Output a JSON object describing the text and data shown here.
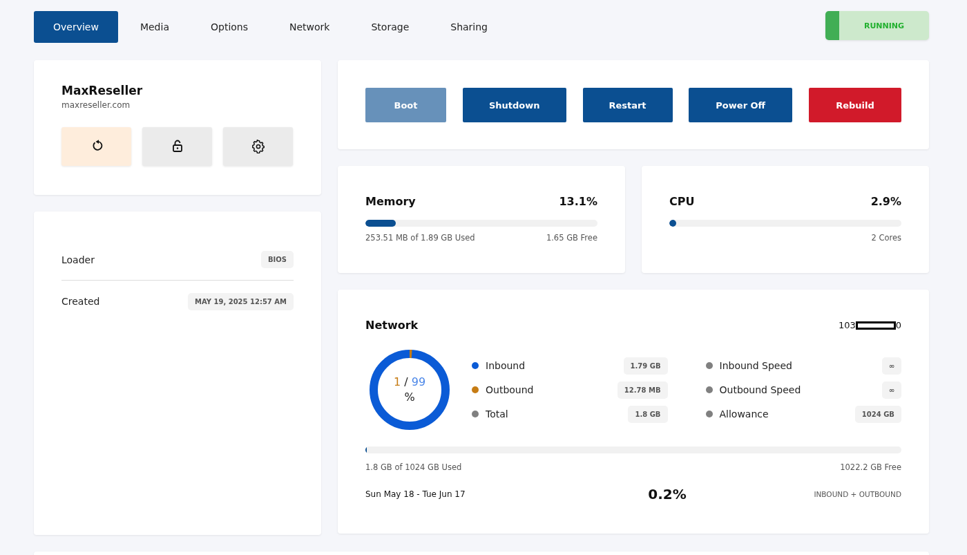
{
  "tabs": [
    {
      "label": "Overview",
      "selected": true
    },
    {
      "label": "Media",
      "selected": false
    },
    {
      "label": "Options",
      "selected": false
    },
    {
      "label": "Network",
      "selected": false
    },
    {
      "label": "Storage",
      "selected": false
    },
    {
      "label": "Sharing",
      "selected": false
    }
  ],
  "status": {
    "label": "RUNNING"
  },
  "server": {
    "name": "MaxReseller",
    "domain": "maxreseller.com",
    "icon_buttons": [
      {
        "kind": "refresh",
        "color": "#feeddc"
      },
      {
        "kind": "unlock",
        "color": "#ebebeb"
      },
      {
        "kind": "settings",
        "color": "#ebebeb"
      }
    ]
  },
  "details": [
    {
      "label": "Loader",
      "value": "BIOS"
    },
    {
      "label": "Created",
      "value": "MAY 19, 2025 12:57 AM"
    }
  ],
  "actions": [
    {
      "label": "Boot",
      "kind": "primary",
      "disabled": true
    },
    {
      "label": "Shutdown",
      "kind": "primary",
      "disabled": false
    },
    {
      "label": "Restart",
      "kind": "primary",
      "disabled": false
    },
    {
      "label": "Power Off",
      "kind": "primary",
      "disabled": false
    },
    {
      "label": "Rebuild",
      "kind": "danger",
      "disabled": false
    }
  ],
  "meters": [
    {
      "title": "Memory",
      "percent": "13.1%",
      "level": 0.131,
      "left": "253.51 MB of 1.89 GB Used",
      "right": "1.65 GB Free"
    },
    {
      "title": "CPU",
      "percent": "2.9%",
      "level": 0.029,
      "right": "2 Cores"
    }
  ],
  "network": {
    "title": "Network",
    "address_start": "103",
    "address_end": "0",
    "donut": {
      "level": 0.01
    },
    "center": {
      "outbound": "1",
      "separator": "/",
      "inbound": "99",
      "unit": "%"
    },
    "stats": [
      {
        "label": "Inbound",
        "value": "1.79 GB",
        "color": "#0b5bd6"
      },
      {
        "label": "Outbound",
        "value": "12.78 MB",
        "color": "#c67c14"
      },
      {
        "label": "Total",
        "value": "1.8 GB",
        "color": "#808080"
      }
    ],
    "limits": [
      {
        "label": "Inbound Speed",
        "value": "∞",
        "color": "#808080"
      },
      {
        "label": "Outbound Speed",
        "value": "∞",
        "color": "#808080"
      },
      {
        "label": "Allowance",
        "value": "1024 GB",
        "color": "#808080"
      }
    ],
    "usage": {
      "level": 0.002,
      "left": "1.8 GB of 1024 GB Used",
      "right": "1022.2 GB Free"
    },
    "period": "Sun May 18 - Tue Jun 17",
    "percent": "0.2%",
    "scope": "INBOUND + OUTBOUND"
  }
}
